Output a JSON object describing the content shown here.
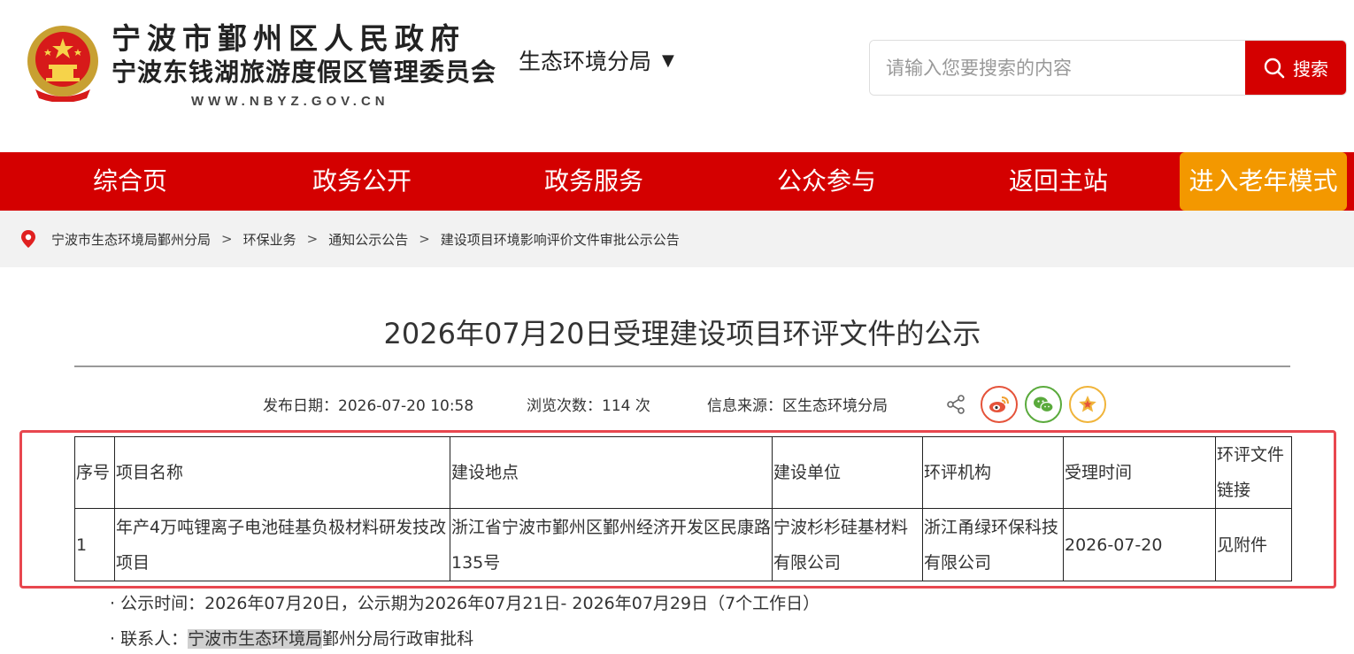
{
  "header": {
    "site_name_line1": "宁波市鄞州区人民政府",
    "site_name_line2": "宁波东钱湖旅游度假区管理委员会",
    "site_url": "WWW.NBYZ.GOV.CN",
    "bureau": "生态环境分局",
    "search": {
      "placeholder": "请输入您要搜索的内容",
      "button_label": "搜索"
    }
  },
  "nav": {
    "items": [
      "综合页",
      "政务公开",
      "政务服务",
      "公众参与",
      "返回主站"
    ],
    "elder_mode": "进入老年模式"
  },
  "breadcrumb": [
    "宁波市生态环境局鄞州分局",
    "环保业务",
    "通知公示公告",
    "建设项目环境影响评价文件审批公示公告"
  ],
  "article": {
    "title": "2026年07月20日受理建设项目环评文件的公示",
    "publish_date": "发布日期：2026-07-20 10:58",
    "views": "浏览次数：114 次",
    "source": "信息来源：区生态环境分局"
  },
  "table": {
    "headers": [
      "序号",
      "项目名称",
      "建设地点",
      "建设单位",
      "环评机构",
      "受理时间",
      "环评文件链接"
    ],
    "rows": [
      [
        "1",
        "年产4万吨锂离子电池硅基负极材料研发技改项目",
        "浙江省宁波市鄞州区鄞州经济开发区民康路135号",
        "宁波杉杉硅基材料有限公司",
        "浙江甬绿环保科技有限公司",
        "2026-07-20",
        "见附件"
      ]
    ]
  },
  "notes": {
    "notice_period": "· 公示时间：2026年07月20日，公示期为2026年07月21日- 2026年07月29日（7个工作日）",
    "contact_label": "· 联系人：",
    "contact_highlight": "宁波市生态环境局",
    "contact_rest": "鄞州分局行政审批科"
  },
  "colors": {
    "brand_red": "#d40000",
    "elder_orange": "#f39800",
    "highlight_border": "#e8474f"
  }
}
